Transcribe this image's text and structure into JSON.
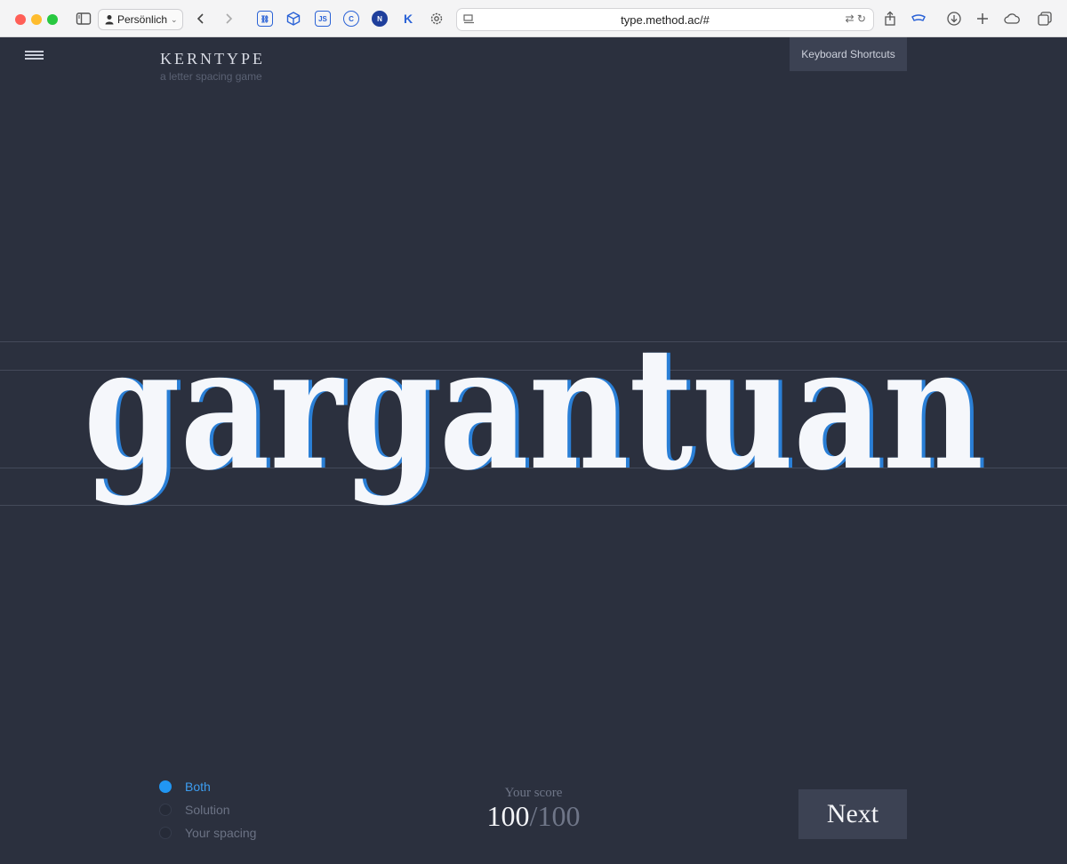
{
  "browser": {
    "profile_label": "Persönlich",
    "url": "type.method.ac/#",
    "extensions": [
      {
        "icon": "link-icon",
        "label": ""
      },
      {
        "icon": "cube-icon",
        "label": ""
      },
      {
        "icon": "js-icon",
        "label": "JS"
      },
      {
        "icon": "circle-c-icon",
        "label": "C"
      },
      {
        "icon": "n-badge-icon",
        "label": "N"
      },
      {
        "icon": "k-icon",
        "label": "K"
      }
    ],
    "colors": {
      "red": "#ff5f57",
      "yellow": "#febc2e",
      "green": "#28c840"
    }
  },
  "app": {
    "brand": "KERNTYPE",
    "tagline": "a letter spacing game",
    "shortcuts_label": "Keyboard Shortcuts",
    "word": "gargantuan",
    "word_colors": {
      "solution": "#f5f7fb",
      "user": "#2a7fd6"
    },
    "view_options": [
      {
        "label": "Both",
        "selected": true
      },
      {
        "label": "Solution",
        "selected": false
      },
      {
        "label": "Your spacing",
        "selected": false
      }
    ],
    "score_label": "Your score",
    "score_value": "100",
    "score_separator": "/",
    "score_max": "100",
    "next_label": "Next",
    "accent": "#2196f3"
  }
}
